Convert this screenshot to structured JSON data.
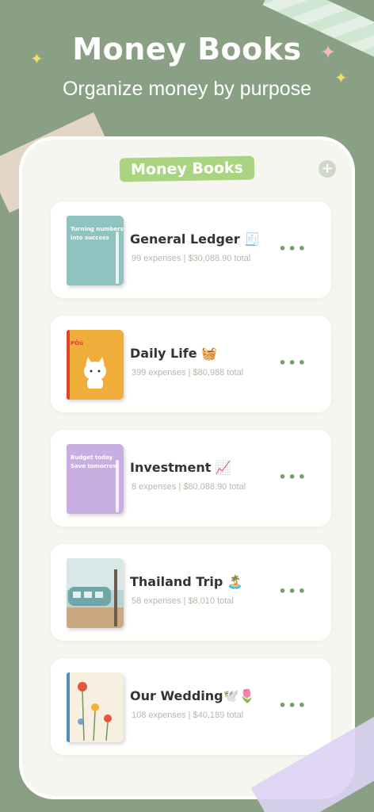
{
  "hero": {
    "title": "Money Books",
    "subtitle": "Organize money by purpose"
  },
  "screen": {
    "header_title": "Money Books",
    "add_icon": "plus-icon",
    "accent_color": "#a9d583"
  },
  "books": [
    {
      "name": "General Ledger 🧾",
      "expenses": "99 expenses",
      "total": "$30,088.90 total",
      "cover_text": "Turning numbers into success",
      "cover_color": "#8fc3c0"
    },
    {
      "name": "Daily Life 🧺",
      "expenses": "399 expenses",
      "total": "$80,988 total",
      "cover_text": "PÖü",
      "cover_color": "#f0ad3a"
    },
    {
      "name": "Investment 📈",
      "expenses": "8 expenses",
      "total": "$80,088.90 total",
      "cover_text": "Budget today Save tomorrow",
      "cover_color": "#c9aee4"
    },
    {
      "name": "Thailand Trip 🏝️",
      "expenses": "58 expenses",
      "total": "$8,010 total",
      "cover_text": "",
      "cover_color": "#9fc2c6"
    },
    {
      "name": "Our Wedding🕊️🌷",
      "expenses": "108 expenses",
      "total": "$40,189 total",
      "cover_text": "",
      "cover_color": "#f7efe0"
    }
  ]
}
